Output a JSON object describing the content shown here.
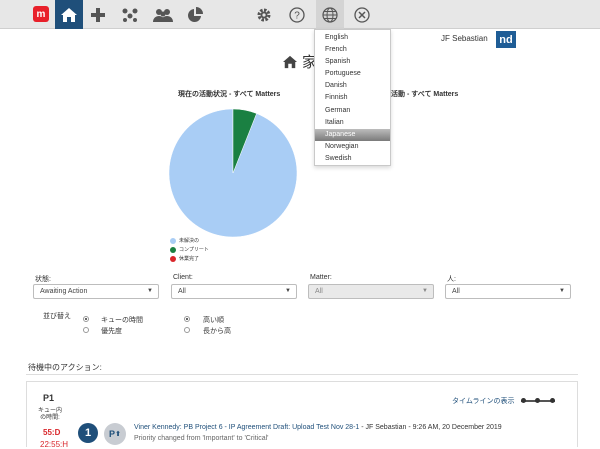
{
  "topbar": {
    "logo_letter": "m",
    "icons": [
      "home-icon",
      "plus-icon",
      "network-icon",
      "team-icon",
      "pie-chart-icon",
      "gear-icon",
      "help-icon",
      "globe-icon",
      "close-icon"
    ]
  },
  "user": {
    "name": "JF Sebastian",
    "brand_badge": "nd"
  },
  "page": {
    "title": "家"
  },
  "charts": {
    "left_title": "現在の活動状況 - すべて Matters",
    "right_title": "活動 - すべて Matters",
    "legend": [
      {
        "label": "未解決の",
        "color": "#a9cdf5"
      },
      {
        "label": "コンプリート",
        "color": "#1a8042"
      },
      {
        "label": "休業完了",
        "color": "#d9262b"
      }
    ]
  },
  "chart_data": {
    "type": "pie",
    "title": "現在の活動状況 - すべて Matters",
    "categories": [
      "未解決の",
      "コンプリート",
      "休業完了"
    ],
    "values": [
      94,
      6,
      0
    ],
    "colors": [
      "#a9cdf5",
      "#1a8042",
      "#d9262b"
    ]
  },
  "language_menu": {
    "items": [
      "English",
      "French",
      "Spanish",
      "Portuguese",
      "Danish",
      "Finnish",
      "German",
      "Italian",
      "Japanese",
      "Norwegian",
      "Swedish"
    ],
    "selected": "Japanese"
  },
  "filters": {
    "status": {
      "label": "状態:",
      "value": "Awaiting Action"
    },
    "client": {
      "label": "Client:",
      "value": "All"
    },
    "matter": {
      "label": "Matter:",
      "value": "All"
    },
    "person": {
      "label": "人:",
      "value": "All"
    }
  },
  "sort": {
    "label": "並び替え",
    "options": [
      "キューの時間",
      "優先度"
    ],
    "orders": [
      "高い順",
      "長から高"
    ]
  },
  "actions": {
    "section_title": "待機中のアクション:",
    "card": {
      "priority": "P1",
      "queue_label_1": "キュー内",
      "queue_label_2": "の時間:",
      "time_1": "55:D",
      "time_2": "22:55:H",
      "timeline_link": "タイムラインの表示",
      "number": "1",
      "badge": "P",
      "entry_link": "Viner Kennedy: PB Project 6 - IP Agreement Draft: Upload Test Nov 28-1",
      "entry_meta": " - JF Sebastian - 9:26 AM, 20 December 2019",
      "entry_sub": "Priority changed from 'Important' to 'Critical'"
    }
  }
}
